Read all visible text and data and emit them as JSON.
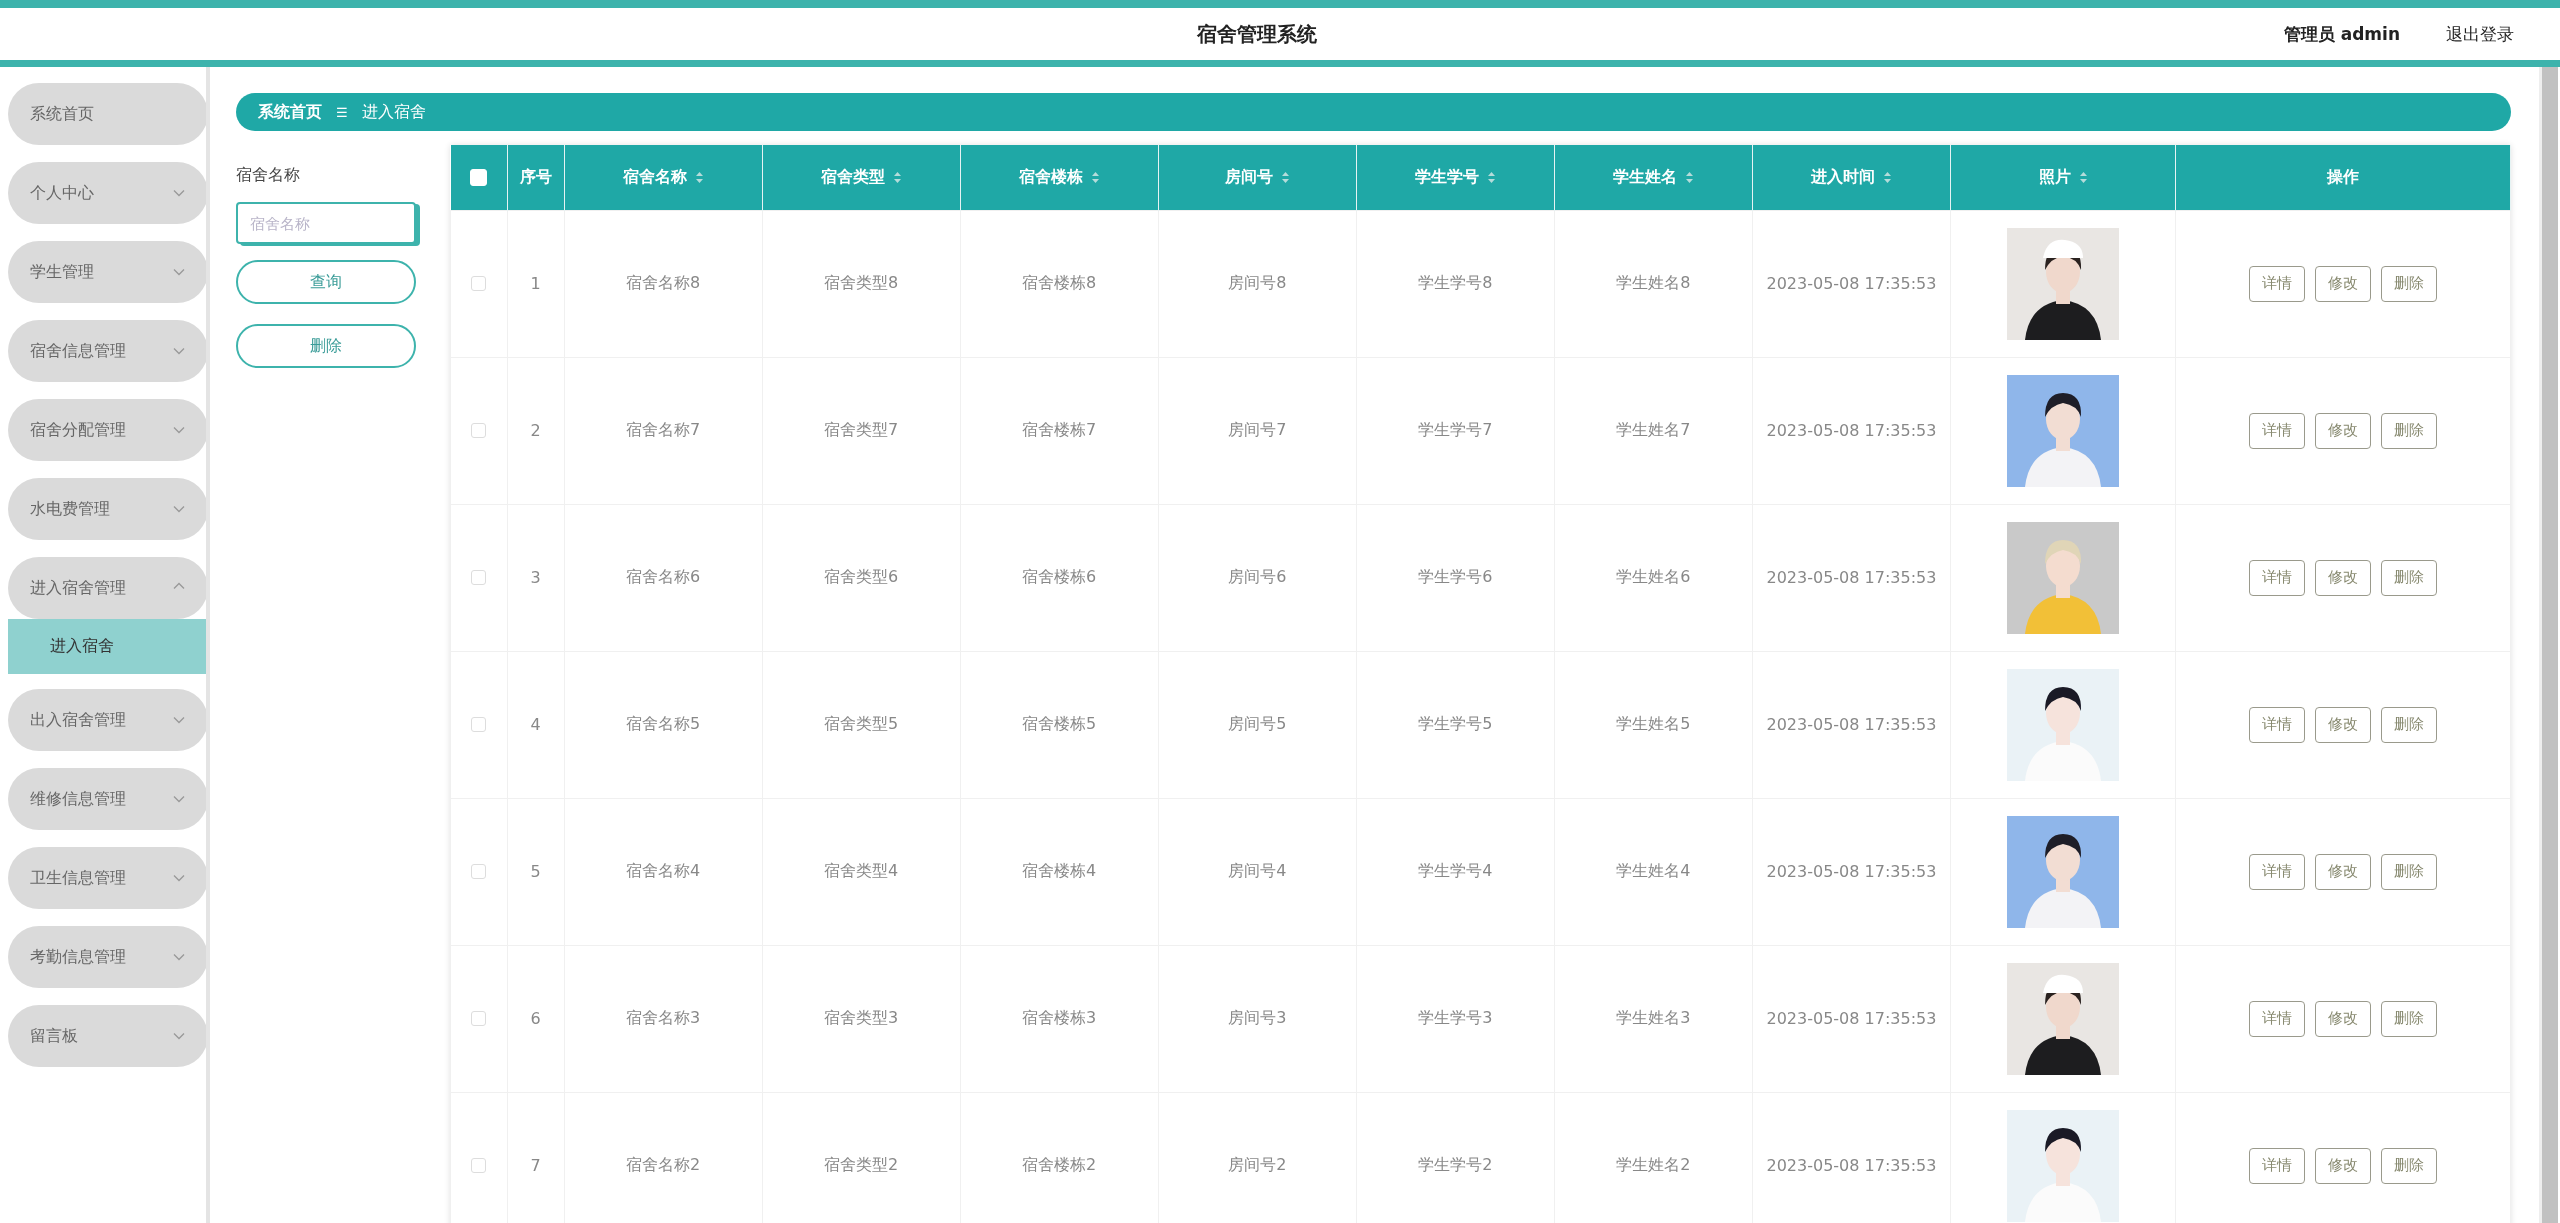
{
  "header": {
    "title": "宿舍管理系统",
    "user": "管理员 admin",
    "logout": "退出登录"
  },
  "sidebar": {
    "items": [
      {
        "label": "系统首页"
      },
      {
        "label": "个人中心",
        "expanded": false
      },
      {
        "label": "学生管理",
        "expanded": false
      },
      {
        "label": "宿舍信息管理",
        "expanded": false
      },
      {
        "label": "宿舍分配管理",
        "expanded": false
      },
      {
        "label": "水电费管理",
        "expanded": false
      },
      {
        "label": "进入宿舍管理",
        "expanded": true,
        "children": [
          {
            "label": "进入宿舍",
            "selected": true
          }
        ]
      },
      {
        "label": "出入宿舍管理",
        "expanded": false
      },
      {
        "label": "维修信息管理",
        "expanded": false
      },
      {
        "label": "卫生信息管理",
        "expanded": false
      },
      {
        "label": "考勤信息管理",
        "expanded": false
      },
      {
        "label": "留言板",
        "expanded": false
      }
    ]
  },
  "breadcrumb": {
    "home": "系统首页",
    "separator": "☰",
    "current": "进入宿舍"
  },
  "search": {
    "label": "宿舍名称",
    "placeholder": "宿舍名称",
    "buttons": [
      "查询",
      "删除"
    ]
  },
  "table": {
    "select_all_checked": false,
    "columns": [
      {
        "label": "序号",
        "sortable": false
      },
      {
        "label": "宿舍名称",
        "sortable": true
      },
      {
        "label": "宿舍类型",
        "sortable": true
      },
      {
        "label": "宿舍楼栋",
        "sortable": true
      },
      {
        "label": "房间号",
        "sortable": true
      },
      {
        "label": "学生学号",
        "sortable": true
      },
      {
        "label": "学生姓名",
        "sortable": true
      },
      {
        "label": "进入时间",
        "sortable": true
      },
      {
        "label": "照片",
        "sortable": true
      },
      {
        "label": "操作",
        "sortable": false
      }
    ],
    "rows": [
      {
        "checked": false,
        "cells": [
          "1",
          "宿舍名称8",
          "宿舍类型8",
          "宿舍楼栋8",
          "房间号8",
          "学生学号8",
          "学生姓名8",
          "2023-05-08 17:35:53"
        ],
        "actions": [
          "详情",
          "修改",
          "删除"
        ]
      },
      {
        "checked": false,
        "cells": [
          "2",
          "宿舍名称7",
          "宿舍类型7",
          "宿舍楼栋7",
          "房间号7",
          "学生学号7",
          "学生姓名7",
          "2023-05-08 17:35:53"
        ],
        "actions": [
          "详情",
          "修改",
          "删除"
        ]
      },
      {
        "checked": false,
        "cells": [
          "3",
          "宿舍名称6",
          "宿舍类型6",
          "宿舍楼栋6",
          "房间号6",
          "学生学号6",
          "学生姓名6",
          "2023-05-08 17:35:53"
        ],
        "actions": [
          "详情",
          "修改",
          "删除"
        ]
      },
      {
        "checked": false,
        "cells": [
          "4",
          "宿舍名称5",
          "宿舍类型5",
          "宿舍楼栋5",
          "房间号5",
          "学生学号5",
          "学生姓名5",
          "2023-05-08 17:35:53"
        ],
        "actions": [
          "详情",
          "修改",
          "删除"
        ]
      },
      {
        "checked": false,
        "cells": [
          "5",
          "宿舍名称4",
          "宿舍类型4",
          "宿舍楼栋4",
          "房间号4",
          "学生学号4",
          "学生姓名4",
          "2023-05-08 17:35:53"
        ],
        "actions": [
          "详情",
          "修改",
          "删除"
        ]
      },
      {
        "checked": false,
        "cells": [
          "6",
          "宿舍名称3",
          "宿舍类型3",
          "宿舍楼栋3",
          "房间号3",
          "学生学号3",
          "学生姓名3",
          "2023-05-08 17:35:53"
        ],
        "actions": [
          "详情",
          "修改",
          "删除"
        ]
      },
      {
        "checked": false,
        "cells": [
          "7",
          "宿舍名称2",
          "宿舍类型2",
          "宿舍楼栋2",
          "房间号2",
          "学生学号2",
          "学生姓名2",
          "2023-05-08 17:35:53"
        ],
        "actions": [
          "详情",
          "修改",
          "删除"
        ]
      }
    ]
  }
}
